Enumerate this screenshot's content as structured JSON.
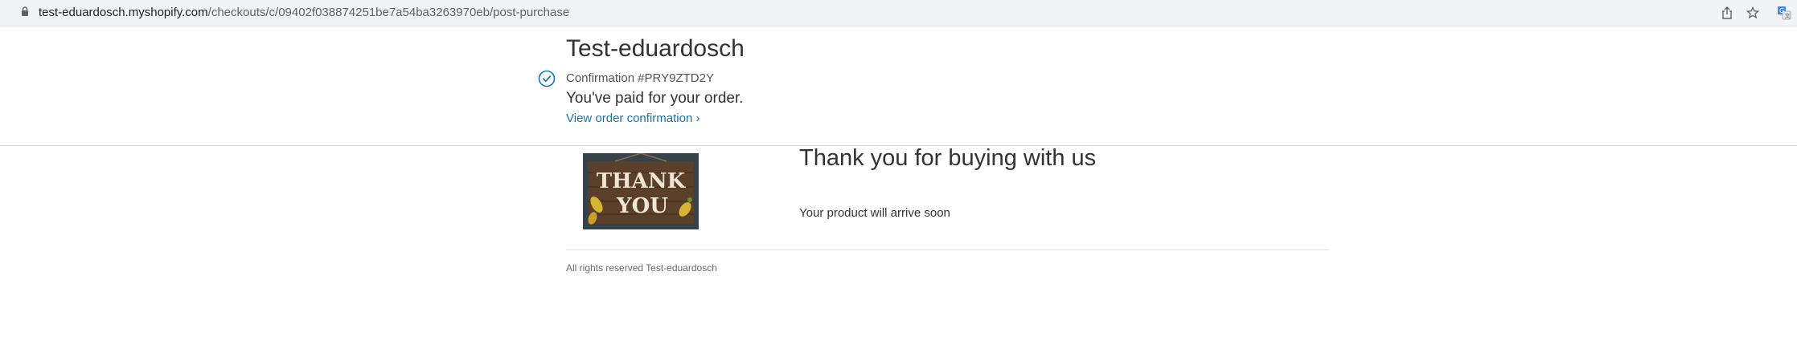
{
  "browser": {
    "url_host": "test-eduardosch.myshopify.com",
    "url_path": "/checkouts/c/09402f038874251be7a54ba3263970eb/post-purchase",
    "icons": [
      "lock-icon",
      "share-icon",
      "bookmark-star-icon",
      "translate-icon"
    ]
  },
  "header": {
    "shop_name": "Test-eduardosch",
    "confirmation_number": "Confirmation #PRY9ZTD2Y",
    "paid_message": "You've paid for your order.",
    "view_confirmation_link": "View order confirmation ›"
  },
  "main": {
    "image_text_line1": "THANK",
    "image_text_line2": "YOU",
    "heading": "Thank you for buying with us",
    "subtext": "Your product will arrive soon"
  },
  "footer": {
    "text": "All rights reserved Test-eduardosch"
  },
  "colors": {
    "link": "#1773b0",
    "check": "#1773b0",
    "text": "#333333"
  }
}
